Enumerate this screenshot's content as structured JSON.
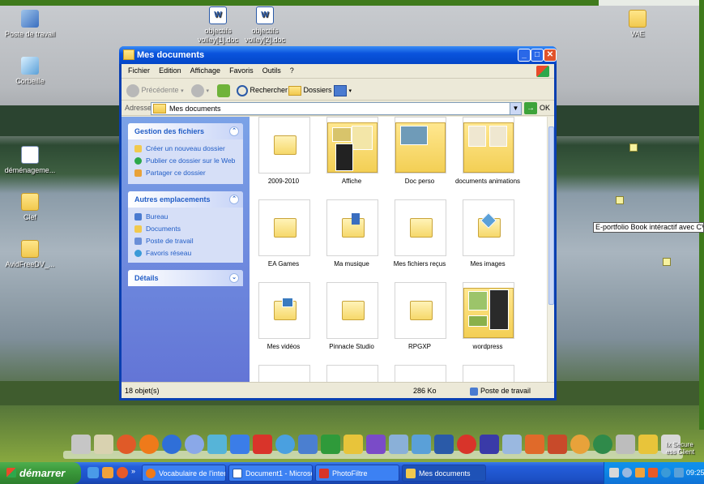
{
  "desktop": {
    "icons": [
      {
        "label": "Poste de travail"
      },
      {
        "label": "Corbeille"
      },
      {
        "label": "déménageme..."
      },
      {
        "label": "Clef"
      },
      {
        "label": "AvidFreeDV_..."
      },
      {
        "label": "objectifs volley[1].doc"
      },
      {
        "label": "objectifs volley[2].doc"
      },
      {
        "label": "VAE"
      }
    ],
    "tooltip": "E-portfolio Book intéractif avec CV, Film..."
  },
  "window": {
    "title": "Mes documents",
    "menu": [
      "Fichier",
      "Edition",
      "Affichage",
      "Favoris",
      "Outils",
      "?"
    ],
    "toolbar": {
      "back": "Précédente",
      "search": "Rechercher",
      "folders": "Dossiers"
    },
    "address": {
      "label": "Adresse",
      "value": "Mes documents",
      "go": "OK"
    },
    "taskpane": {
      "file_tasks": {
        "title": "Gestion des fichiers",
        "items": [
          "Créer un nouveau dossier",
          "Publier ce dossier sur le Web",
          "Partager ce dossier"
        ]
      },
      "other_places": {
        "title": "Autres emplacements",
        "items": [
          "Bureau",
          "Documents",
          "Poste de travail",
          "Favoris réseau"
        ]
      },
      "details": {
        "title": "Détails"
      }
    },
    "files": [
      {
        "name": "2009-2010"
      },
      {
        "name": "Affiche"
      },
      {
        "name": "Doc perso"
      },
      {
        "name": "documents animations"
      },
      {
        "name": "EA Games"
      },
      {
        "name": "Ma musique"
      },
      {
        "name": "Mes fichiers reçus"
      },
      {
        "name": "Mes images"
      },
      {
        "name": "Mes vidéos"
      },
      {
        "name": "Pinnacle Studio"
      },
      {
        "name": "RPGXP"
      },
      {
        "name": "wordpress"
      }
    ],
    "status": {
      "count": "18 objet(s)",
      "size": "286 Ko",
      "location": "Poste de travail"
    }
  },
  "dock": {
    "label": "Ix Secure ess Client"
  },
  "taskbar": {
    "start": "démarrer",
    "more": "»",
    "tasks": [
      {
        "label": "Vocabulaire de l'inter..."
      },
      {
        "label": "Document1 - Microsof..."
      },
      {
        "label": "PhotoFiltre"
      },
      {
        "label": "Mes documents"
      }
    ],
    "clock": "09:25"
  },
  "colors": {
    "title_blue": "#0a54dd",
    "taskpane_link": "#215dc6",
    "start_green": "#3b9a3b",
    "frame_green": "#3f7a1c"
  }
}
